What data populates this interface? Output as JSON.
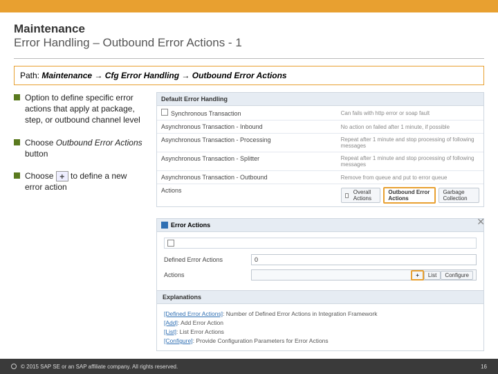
{
  "header": {
    "title": "Maintenance",
    "subtitle": "Error Handling – Outbound Error Actions - 1"
  },
  "path": {
    "label": "Path:",
    "value": "Maintenance → Cfg Error Handling → Outbound Error Actions"
  },
  "bullets": {
    "b1": "Option to define specific error actions that apply at package, step, or outbound channel level",
    "b2a": "Choose ",
    "b2b": "Outbound Error Actions",
    "b2c": " button",
    "b3a": "Choose ",
    "b3b": " to define a new error action"
  },
  "panel1": {
    "title": "Default Error Handling",
    "rows": [
      {
        "l": "Synchronous Transaction",
        "r": "Can fails with http error or soap fault"
      },
      {
        "l": "Asynchronous Transaction - Inbound",
        "r": "No action on failed after 1 minute, if possible"
      },
      {
        "l": "Asynchronous Transaction - Processing",
        "r": "Repeat after 1 minute and stop processing of following messages"
      },
      {
        "l": "Asynchronous Transaction - Splitter",
        "r": "Repeat after 1 minute and stop processing of following messages"
      },
      {
        "l": "Asynchronous Transaction - Outbound",
        "r": "Remove from queue and put to error queue"
      }
    ],
    "actions_label": "Actions",
    "tabs": {
      "t1": "Overall Actions",
      "t2": "Outbound Error Actions",
      "t3": "Garbage Collection"
    }
  },
  "panel2": {
    "title": "Error Actions",
    "form": {
      "f1_label": "Defined Error Actions",
      "f1_value": "0",
      "f2_label": "Actions",
      "btn_add": "+",
      "btn_list": "List",
      "btn_conf": "Configure"
    },
    "expl_title": "Explanations",
    "expl": [
      {
        "k": "[Defined Error Actions]",
        "t": ": Number of Defined Error Actions in Integration Framework"
      },
      {
        "k": "[Add]",
        "t": ": Add Error Action"
      },
      {
        "k": "[List]",
        "t": ": List Error Actions"
      },
      {
        "k": "[Configure]",
        "t": ": Provide Configuration Parameters for Error Actions"
      }
    ]
  },
  "footer": {
    "copyright": "© 2015 SAP SE or an SAP affiliate company. All rights reserved.",
    "page": "16"
  }
}
